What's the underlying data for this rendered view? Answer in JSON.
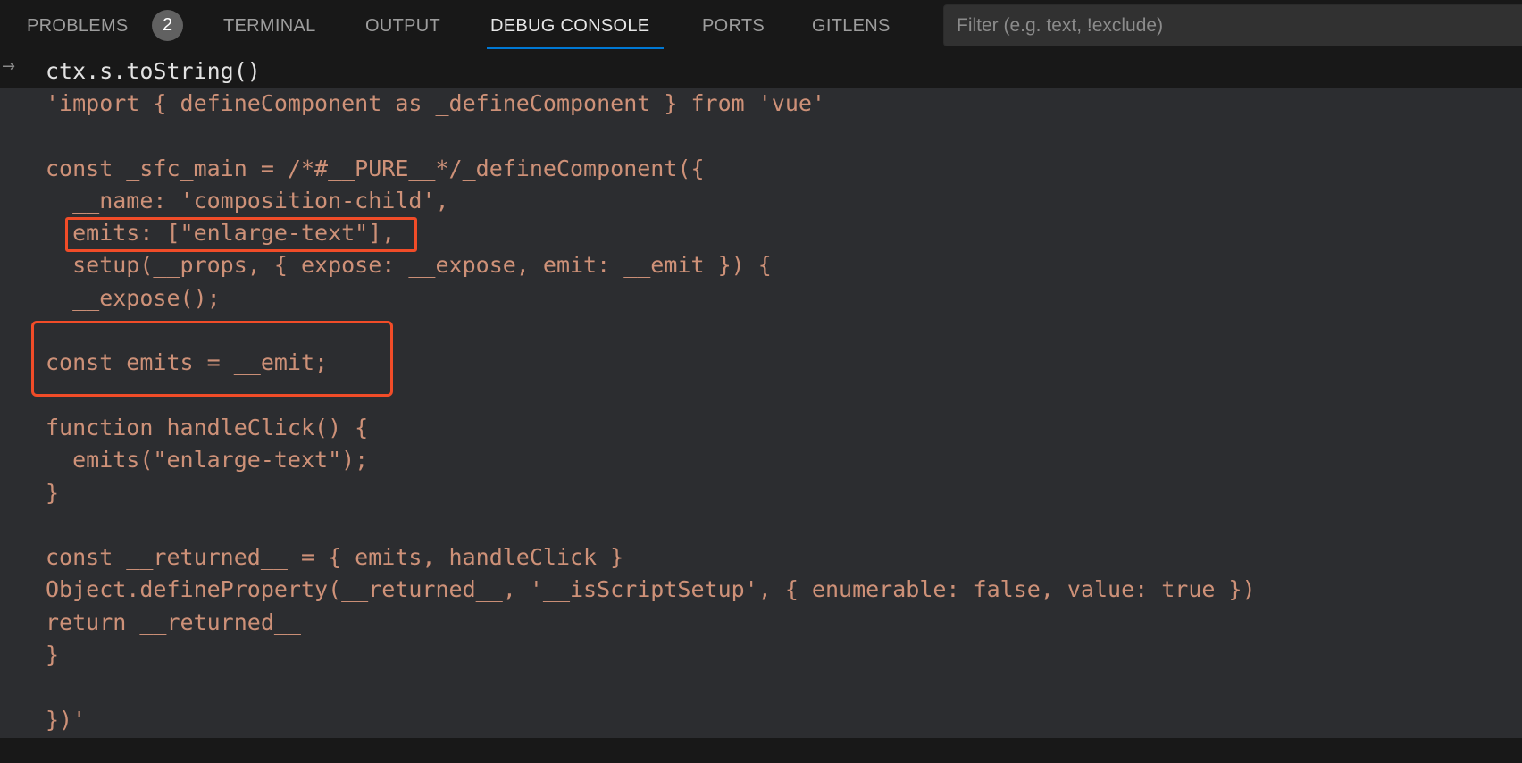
{
  "panel": {
    "tabs": [
      {
        "label": "PROBLEMS",
        "badge": "2",
        "active": false
      },
      {
        "label": "TERMINAL",
        "active": false
      },
      {
        "label": "OUTPUT",
        "active": false
      },
      {
        "label": "DEBUG CONSOLE",
        "active": true
      },
      {
        "label": "PORTS",
        "active": false
      },
      {
        "label": "GITLENS",
        "active": false
      }
    ],
    "filter": {
      "value": "",
      "placeholder": "Filter (e.g. text, !exclude)"
    },
    "accent_color": "#0078d4"
  },
  "console": {
    "input_icon": "arrow-right-icon",
    "input_arrow_glyph": "→",
    "input_expression": "ctx.s.toString()",
    "output_color": "#ce9178",
    "output_lines": [
      "'import { defineComponent as _defineComponent } from 'vue'",
      "",
      "const _sfc_main = /*#__PURE__*/_defineComponent({",
      "  __name: 'composition-child',",
      "  emits: [\"enlarge-text\"],",
      "  setup(__props, { expose: __expose, emit: __emit }) {",
      "  __expose();",
      "",
      "const emits = __emit;",
      "",
      "function handleClick() {",
      "  emits(\"enlarge-text\");",
      "}",
      "",
      "const __returned__ = { emits, handleClick }",
      "Object.defineProperty(__returned__, '__isScriptSetup', { enumerable: false, value: true })",
      "return __returned__",
      "}",
      "",
      "})'"
    ]
  },
  "annotations": {
    "highlight_color": "#f14c28",
    "boxes": [
      {
        "label": "emits-option-highlight",
        "covers_line": "  emits: [\"enlarge-text\"],"
      },
      {
        "label": "const-emits-highlight",
        "covers_line": "const emits = __emit;"
      }
    ]
  }
}
